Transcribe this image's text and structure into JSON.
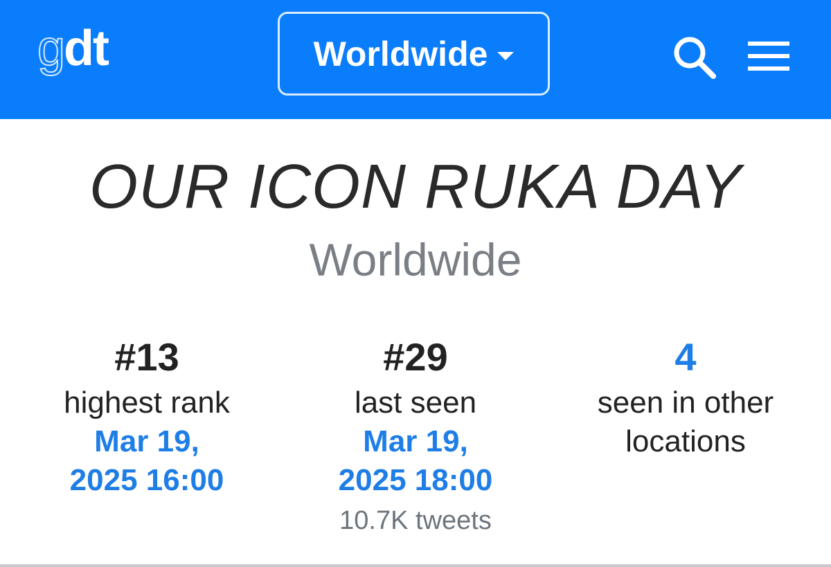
{
  "header": {
    "logo_g": "g",
    "logo_dt": "dt",
    "location_selected": "Worldwide",
    "search_icon": "search-icon",
    "menu_icon": "menu-icon"
  },
  "colors": {
    "navbar": "#0a7dfc",
    "link": "#1e7ee6",
    "muted": "#7a7f85"
  },
  "trend": {
    "title": "OUR ICON RUKA DAY",
    "location": "Worldwide"
  },
  "stats": [
    {
      "value": "#13",
      "label": "highest rank",
      "date_line1": "Mar 19,",
      "date_line2": "2025 16:00"
    },
    {
      "value": "#29",
      "label": "last seen",
      "date_line1": "Mar 19,",
      "date_line2": "2025 18:00",
      "tweets": "10.7K tweets"
    },
    {
      "value": "4",
      "label_line1": "seen in other",
      "label_line2": "locations"
    }
  ]
}
